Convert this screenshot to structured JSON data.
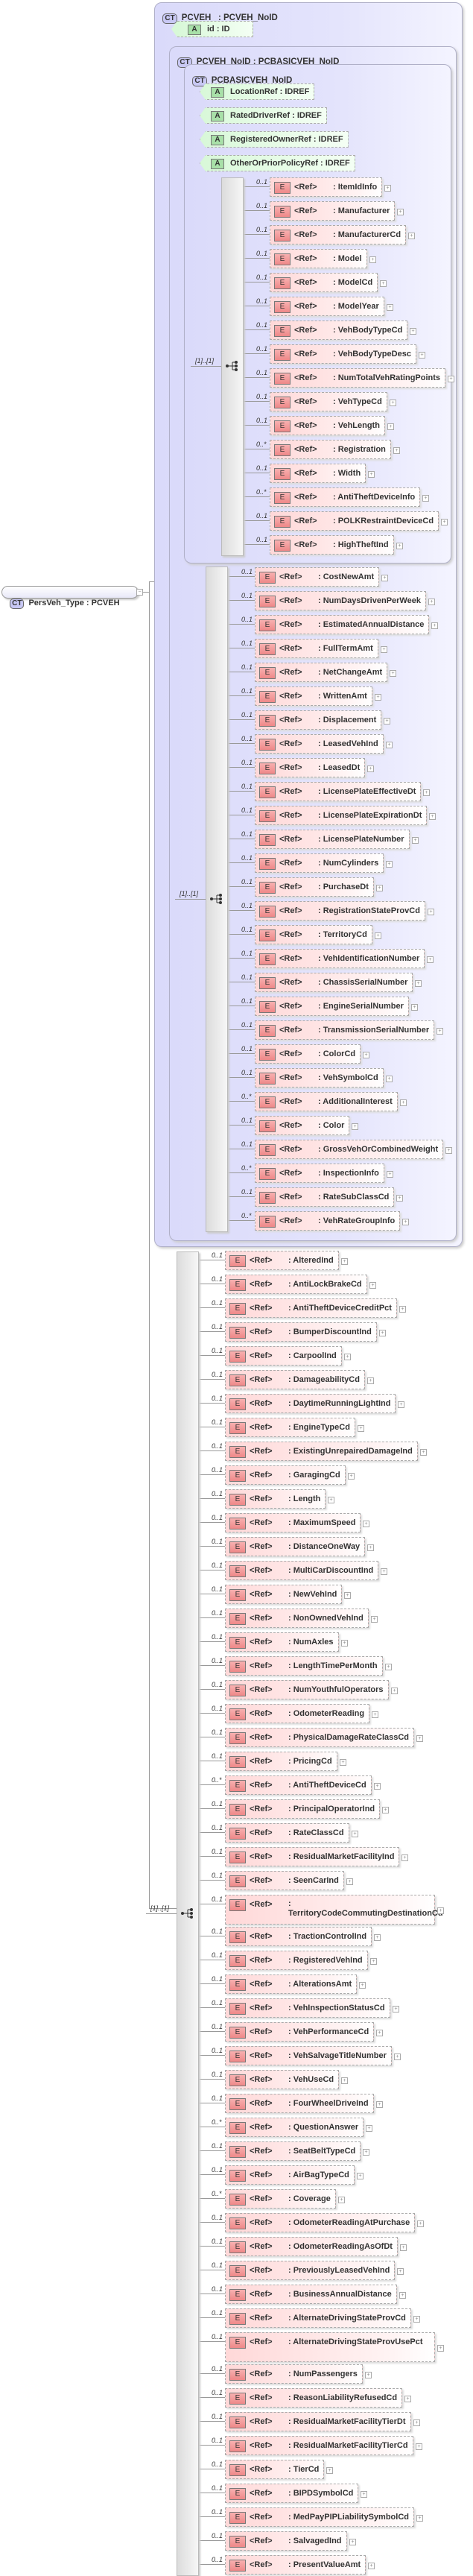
{
  "root": {
    "badge": "CT",
    "label": "PersVeh_Type : PCVEH"
  },
  "pcveh": {
    "badge": "CT",
    "label": "PCVEH   : PCVEH_NoID"
  },
  "id_attr": {
    "badge": "A",
    "label": "id          : ID"
  },
  "pcveh_noid": {
    "badge": "CT",
    "label": "PCVEH_NoID : PCBASICVEH_NoID"
  },
  "pcbasicveh": {
    "badge": "CT",
    "label": "PCBASICVEH_NoID"
  },
  "attributes": [
    {
      "badge": "A",
      "label": "LocationRef : IDREF"
    },
    {
      "badge": "A",
      "label": "RatedDriverRef : IDREF"
    },
    {
      "badge": "A",
      "label": "RegisteredOwnerRef : IDREF"
    },
    {
      "badge": "A",
      "label": "OtherOrPriorPolicyRef : IDREF"
    }
  ],
  "occurrence": "[1]..[1]",
  "element_badge": "E",
  "ref_label": "<Ref>",
  "groups": [
    {
      "items": [
        [
          "0..1",
          "ItemIdInfo"
        ],
        [
          "0..1",
          "Manufacturer"
        ],
        [
          "0..1",
          "ManufacturerCd"
        ],
        [
          "0..1",
          "Model"
        ],
        [
          "0..1",
          "ModelCd"
        ],
        [
          "0..1",
          "ModelYear"
        ],
        [
          "0..1",
          "VehBodyTypeCd"
        ],
        [
          "0..1",
          "VehBodyTypeDesc"
        ],
        [
          "0..1",
          "NumTotalVehRatingPoints"
        ],
        [
          "0..1",
          "VehTypeCd"
        ],
        [
          "0..1",
          "VehLength"
        ],
        [
          "0..*",
          "Registration"
        ],
        [
          "0..1",
          "Width"
        ],
        [
          "0..*",
          "AntiTheftDeviceInfo"
        ],
        [
          "0..1",
          "POLKRestraintDeviceCd"
        ],
        [
          "0..1",
          "HighTheftInd"
        ]
      ]
    },
    {
      "items": [
        [
          "0..1",
          "CostNewAmt"
        ],
        [
          "0..1",
          "NumDaysDrivenPerWeek"
        ],
        [
          "0..1",
          "EstimatedAnnualDistance"
        ],
        [
          "0..1",
          "FullTermAmt"
        ],
        [
          "0..1",
          "NetChangeAmt"
        ],
        [
          "0..1",
          "WrittenAmt"
        ],
        [
          "0..1",
          "Displacement"
        ],
        [
          "0..1",
          "LeasedVehInd"
        ],
        [
          "0..1",
          "LeasedDt"
        ],
        [
          "0..1",
          "LicensePlateEffectiveDt"
        ],
        [
          "0..1",
          "LicensePlateExpirationDt"
        ],
        [
          "0..1",
          "LicensePlateNumber"
        ],
        [
          "0..1",
          "NumCylinders"
        ],
        [
          "0..1",
          "PurchaseDt"
        ],
        [
          "0..1",
          "RegistrationStateProvCd"
        ],
        [
          "0..1",
          "TerritoryCd"
        ],
        [
          "0..1",
          "VehIdentificationNumber"
        ],
        [
          "0..1",
          "ChassisSerialNumber"
        ],
        [
          "0..1",
          "EngineSerialNumber"
        ],
        [
          "0..1",
          "TransmissionSerialNumber"
        ],
        [
          "0..1",
          "ColorCd"
        ],
        [
          "0..1",
          "VehSymbolCd"
        ],
        [
          "0..*",
          "AdditionalInterest"
        ],
        [
          "0..1",
          "Color"
        ],
        [
          "0..1",
          "GrossVehOrCombinedWeight"
        ],
        [
          "0..*",
          "InspectionInfo"
        ],
        [
          "0..1",
          "RateSubClassCd"
        ],
        [
          "0..*",
          "VehRateGroupInfo"
        ]
      ]
    },
    {
      "items": [
        [
          "0..1",
          "AlteredInd"
        ],
        [
          "0..1",
          "AntiLockBrakeCd"
        ],
        [
          "0..1",
          "AntiTheftDeviceCreditPct"
        ],
        [
          "0..1",
          "BumperDiscountInd"
        ],
        [
          "0..1",
          "CarpoolInd"
        ],
        [
          "0..1",
          "DamageabilityCd"
        ],
        [
          "0..1",
          "DaytimeRunningLightInd"
        ],
        [
          "0..1",
          "EngineTypeCd"
        ],
        [
          "0..1",
          "ExistingUnrepairedDamageInd"
        ],
        [
          "0..1",
          "GaragingCd"
        ],
        [
          "0..1",
          "Length"
        ],
        [
          "0..1",
          "MaximumSpeed"
        ],
        [
          "0..1",
          "DistanceOneWay"
        ],
        [
          "0..1",
          "MultiCarDiscountInd"
        ],
        [
          "0..1",
          "NewVehInd"
        ],
        [
          "0..1",
          "NonOwnedVehInd"
        ],
        [
          "0..1",
          "NumAxles"
        ],
        [
          "0..1",
          "LengthTimePerMonth"
        ],
        [
          "0..1",
          "NumYouthfulOperators"
        ],
        [
          "0..1",
          "OdometerReading"
        ],
        [
          "0..1",
          "PhysicalDamageRateClassCd"
        ],
        [
          "0..1",
          "PricingCd"
        ],
        [
          "0..*",
          "AntiTheftDeviceCd"
        ],
        [
          "0..1",
          "PrincipalOperatorInd"
        ],
        [
          "0..1",
          "RateClassCd"
        ],
        [
          "0..1",
          "ResidualMarketFacilityInd"
        ],
        [
          "0..1",
          "SeenCarInd"
        ],
        [
          "0..1",
          "TerritoryCodeCommutingDestinationCd"
        ],
        [
          "0..1",
          "TractionControlInd"
        ],
        [
          "0..1",
          "RegisteredVehInd"
        ],
        [
          "0..1",
          "AlterationsAmt"
        ],
        [
          "0..1",
          "VehInspectionStatusCd"
        ],
        [
          "0..1",
          "VehPerformanceCd"
        ],
        [
          "0..1",
          "VehSalvageTitleNumber"
        ],
        [
          "0..1",
          "VehUseCd"
        ],
        [
          "0..1",
          "FourWheelDriveInd"
        ],
        [
          "0..*",
          "QuestionAnswer"
        ],
        [
          "0..1",
          "SeatBeltTypeCd"
        ],
        [
          "0..1",
          "AirBagTypeCd"
        ],
        [
          "0..*",
          "Coverage"
        ],
        [
          "0..1",
          "OdometerReadingAtPurchase"
        ],
        [
          "0..1",
          "OdometerReadingAsOfDt"
        ],
        [
          "0..1",
          "PreviouslyLeasedVehInd"
        ],
        [
          "0..1",
          "BusinessAnnualDistance"
        ],
        [
          "0..1",
          "AlternateDrivingStateProvCd"
        ],
        [
          "0..1",
          "AlternateDrivingStateProvUsePct"
        ],
        [
          "0..1",
          "NumPassengers"
        ],
        [
          "0..1",
          "ReasonLiabilityRefusedCd"
        ],
        [
          "0..1",
          "ResidualMarketFacilityTierDt"
        ],
        [
          "0..1",
          "ResidualMarketFacilityTierCd"
        ],
        [
          "0..1",
          "TierCd"
        ],
        [
          "0..1",
          "BIPDSymbolCd"
        ],
        [
          "0..1",
          "MedPayPIPLiabilitySymbolCd"
        ],
        [
          "0..1",
          "SalvagedInd"
        ],
        [
          "0..1",
          "PresentValueAmt"
        ]
      ]
    }
  ],
  "colors": {
    "complex_type": "#dadafa",
    "attribute": "#d8f8d8",
    "element": "#ffd8d8"
  }
}
